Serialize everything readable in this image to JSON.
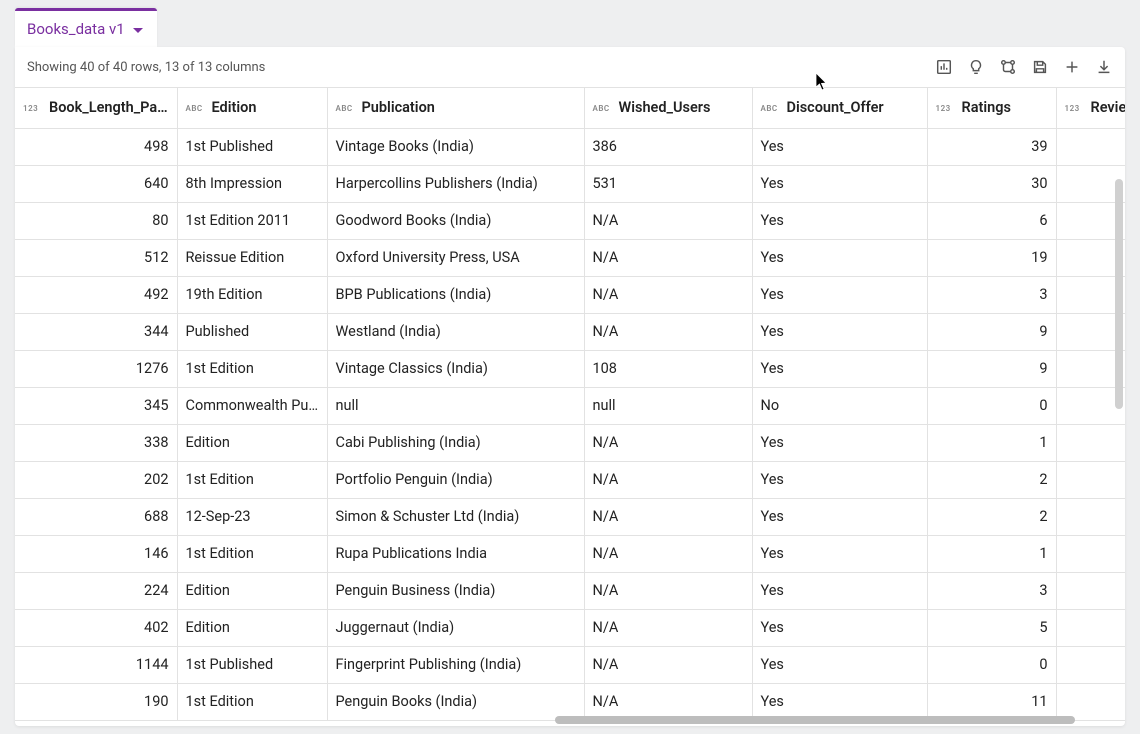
{
  "tab": {
    "title": "Books_data v1"
  },
  "status": "Showing 40 of 40 rows, 13 of 13 columns",
  "columns": [
    {
      "key": "length",
      "label": "Book_Length_Pa…",
      "type": "123",
      "klass": "c-len num"
    },
    {
      "key": "edition",
      "label": "Edition",
      "type": "ABC",
      "klass": "c-ed"
    },
    {
      "key": "pub",
      "label": "Publication",
      "type": "ABC",
      "klass": "c-pub"
    },
    {
      "key": "wished",
      "label": "Wished_Users",
      "type": "ABC",
      "klass": "c-wu"
    },
    {
      "key": "discount",
      "label": "Discount_Offer",
      "type": "ABC",
      "klass": "c-disc"
    },
    {
      "key": "ratings",
      "label": "Ratings",
      "type": "123",
      "klass": "c-rat num"
    },
    {
      "key": "reviews",
      "label": "Review",
      "type": "123",
      "klass": "c-rev num"
    }
  ],
  "rows": [
    {
      "length": "498",
      "edition": "1st Published",
      "pub": "Vintage Books (India)",
      "wished": "386",
      "discount": "Yes",
      "ratings": "39",
      "reviews": ""
    },
    {
      "length": "640",
      "edition": "8th Impression",
      "pub": "Harpercollins Publishers (India)",
      "wished": "531",
      "discount": "Yes",
      "ratings": "30",
      "reviews": ""
    },
    {
      "length": "80",
      "edition": "1st Edition 2011",
      "pub": "Goodword Books (India)",
      "wished": "N/A",
      "discount": "Yes",
      "ratings": "6",
      "reviews": ""
    },
    {
      "length": "512",
      "edition": "Reissue Edition",
      "pub": "Oxford University Press, USA",
      "wished": "N/A",
      "discount": "Yes",
      "ratings": "19",
      "reviews": ""
    },
    {
      "length": "492",
      "edition": "19th Edition",
      "pub": "BPB Publications (India)",
      "wished": "N/A",
      "discount": "Yes",
      "ratings": "3",
      "reviews": ""
    },
    {
      "length": "344",
      "edition": "Published",
      "pub": "Westland (India)",
      "wished": "N/A",
      "discount": "Yes",
      "ratings": "9",
      "reviews": ""
    },
    {
      "length": "1276",
      "edition": "1st Edition",
      "pub": "Vintage Classics (India)",
      "wished": "108",
      "discount": "Yes",
      "ratings": "9",
      "reviews": ""
    },
    {
      "length": "345",
      "edition": "Commonwealth Pub.",
      "pub": "null",
      "wished": "null",
      "discount": "No",
      "ratings": "0",
      "reviews": ""
    },
    {
      "length": "338",
      "edition": "Edition",
      "pub": "Cabi Publishing (India)",
      "wished": "N/A",
      "discount": "Yes",
      "ratings": "1",
      "reviews": ""
    },
    {
      "length": "202",
      "edition": "1st Edition",
      "pub": "Portfolio Penguin (India)",
      "wished": "N/A",
      "discount": "Yes",
      "ratings": "2",
      "reviews": ""
    },
    {
      "length": "688",
      "edition": "12-Sep-23",
      "pub": "Simon & Schuster Ltd (India)",
      "wished": "N/A",
      "discount": "Yes",
      "ratings": "2",
      "reviews": ""
    },
    {
      "length": "146",
      "edition": "1st Edition",
      "pub": "Rupa Publications India",
      "wished": "N/A",
      "discount": "Yes",
      "ratings": "1",
      "reviews": ""
    },
    {
      "length": "224",
      "edition": "Edition",
      "pub": "Penguin Business (India)",
      "wished": "N/A",
      "discount": "Yes",
      "ratings": "3",
      "reviews": ""
    },
    {
      "length": "402",
      "edition": "Edition",
      "pub": "Juggernaut (India)",
      "wished": "N/A",
      "discount": "Yes",
      "ratings": "5",
      "reviews": ""
    },
    {
      "length": "1144",
      "edition": "1st Published",
      "pub": "Fingerprint Publishing (India)",
      "wished": "N/A",
      "discount": "Yes",
      "ratings": "0",
      "reviews": ""
    },
    {
      "length": "190",
      "edition": "1st Edition",
      "pub": "Penguin Books (India)",
      "wished": "N/A",
      "discount": "Yes",
      "ratings": "11",
      "reviews": ""
    }
  ]
}
